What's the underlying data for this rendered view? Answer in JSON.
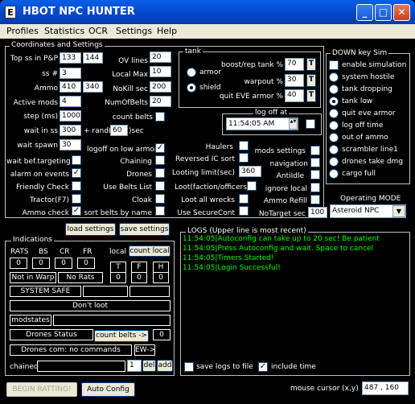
{
  "window": {
    "title": "HBOT NPC HUNTER",
    "minimize": "_",
    "maximize": "□",
    "close": "✕"
  },
  "menu": [
    "Profiles",
    "Statistics",
    "OCR",
    "Settings",
    "Help"
  ],
  "coords": {
    "legend": "Coordinates and Settings",
    "top_ss": {
      "label": "Top ss in P&P",
      "v1": "133",
      "v2": "144"
    },
    "ss_num": {
      "label": "ss #",
      "v": "3"
    },
    "ammo": {
      "label": "Ammo",
      "v1": "410",
      "v2": "340"
    },
    "active_mods": {
      "label": "Active mods",
      "v": "4"
    },
    "step": {
      "label": "step (ms)",
      "v": "1000"
    },
    "wait_ss": {
      "label": "wait in ss",
      "v": "300"
    },
    "rand": {
      "label": "+ rand(",
      "v": "60",
      "suffix": ")sec"
    },
    "wait_spawn": {
      "label": "wait spawn",
      "v": "30"
    },
    "ov_lines": {
      "label": "OV lines",
      "v": "20"
    },
    "local_max": {
      "label": "Local Max",
      "v": "10"
    },
    "nokill_sec": {
      "label": "NoKill sec",
      "v": "200"
    },
    "num_belts": {
      "label": "NumOfBelts",
      "v": "20"
    },
    "count_belts": {
      "label": "count belts",
      "checked": false
    },
    "logoff_low_armor": {
      "label": "logoff on low armor",
      "checked": true
    },
    "wait_targeting": {
      "label": "wait bef.targeting",
      "checked": false
    },
    "alarm_events": {
      "label": "alarm on events",
      "checked": true
    },
    "friendly_check": {
      "label": "Friendly Check",
      "checked": false
    },
    "tractor": {
      "label": "Tractor(F7)",
      "checked": false
    },
    "ammo_check": {
      "label": "Ammo check",
      "checked": true
    },
    "chaining": {
      "label": "Chaining",
      "checked": false
    },
    "drones": {
      "label": "Drones",
      "checked": false
    },
    "use_belts_list": {
      "label": "Use Belts List",
      "checked": false
    },
    "cloak": {
      "label": "Cloak",
      "checked": false
    },
    "sort_belts": {
      "label": "sort belts by name",
      "checked": false
    },
    "haulers": {
      "label": "Haulers",
      "checked": false
    },
    "reversed_ic": {
      "label": "Reversed IC sort",
      "checked": false
    },
    "looting_limit": {
      "label": "Looting limit(sec)",
      "v": "360"
    },
    "loot_faction": {
      "label": "Loot(faction/officers)",
      "checked": false
    },
    "loot_all_wrecks": {
      "label": "Loot all wrecks",
      "checked": false
    },
    "use_securecont": {
      "label": "Use SecureCont",
      "checked": false
    },
    "mods_settings": {
      "label": "mods settings",
      "checked": false
    },
    "navigation": {
      "label": "navigation",
      "checked": false
    },
    "antiidle": {
      "label": "AntiIdle",
      "checked": false
    },
    "ignore_local": {
      "label": "ignore local",
      "checked": false
    },
    "ammo_refill": {
      "label": "Ammo Refill",
      "checked": false
    },
    "notarget_sec": {
      "label": "NoTarget sec",
      "v": "100"
    }
  },
  "tank": {
    "legend": "tank",
    "armor": "armor",
    "shield": "shield",
    "selected": "shield",
    "boost": {
      "label": "boost/rep tank %",
      "v": "70",
      "t": "T"
    },
    "warpout": {
      "label": "warpout %",
      "v": "30",
      "t": "T"
    },
    "quit_eve": {
      "label": "quit EVE armor %",
      "v": "40",
      "t": "T"
    }
  },
  "logoff": {
    "legend": "log off at",
    "time": "11:54:05 AM",
    "spin": "▲▼",
    "checked": false
  },
  "downkey": {
    "legend": "DOWN key Sim",
    "items": [
      {
        "label": "enable simulation",
        "type": "check",
        "checked": false
      },
      {
        "label": "system hostile",
        "type": "radio",
        "checked": false
      },
      {
        "label": "tank dropping",
        "type": "radio",
        "checked": false
      },
      {
        "label": "tank low",
        "type": "radio",
        "checked": true
      },
      {
        "label": "quit eve armor",
        "type": "radio",
        "checked": false
      },
      {
        "label": "log off time",
        "type": "radio",
        "checked": false
      },
      {
        "label": "out of ammo",
        "type": "radio",
        "checked": false
      },
      {
        "label": "scrambler line1",
        "type": "radio",
        "checked": false
      },
      {
        "label": "drones take dmg",
        "type": "radio",
        "checked": false
      },
      {
        "label": "cargo full",
        "type": "radio",
        "checked": false
      }
    ]
  },
  "mode": {
    "label": "Operating MODE",
    "value": "Asteroid NPC",
    "arrow": "▼"
  },
  "buttons": {
    "load": "load settings",
    "save": "save settings",
    "begin": "BEGIN RATTING!",
    "auto": "Auto Config"
  },
  "indications": {
    "legend": "Indications",
    "rats": "RATS",
    "bs": "BS",
    "cr": "CR",
    "fr": "FR",
    "local": "local",
    "count_local": "count local",
    "vals": [
      "0",
      "0",
      "0",
      "0"
    ],
    "t": "T",
    "f": "F",
    "h": "H",
    "tfh": [
      "0",
      "0",
      "0"
    ],
    "not_in_warp": "Not in Warp",
    "no_rats": "No Rats",
    "system_safe": "SYSTEM SAFE",
    "dont_loot": "Don't loot",
    "modstates": "modstates",
    "drones_status": "Drones Status",
    "count_belts_btn": "count belts ->",
    "belts_count": "0",
    "drones_com": "Drones com: no commands",
    "ew": "EW->",
    "chained": "chained",
    "chained_num": "1",
    "del": "del",
    "add": "add"
  },
  "logs": {
    "legend": "LOGS (Upper line is most recent)",
    "lines": [
      "11:54:05|Autoconfig can take up to 20 sec! Be patient",
      "11:54:05|Press Autoconfig and wait. Space to cancel",
      "11:54:05|Timers Started!",
      "11:54:05|Login Successful!"
    ],
    "save_logs": {
      "label": "save logs to file",
      "checked": false
    },
    "include_time": {
      "label": "include time",
      "checked": true
    }
  },
  "cursor": {
    "label": "mouse cursor (x,y)",
    "value": "487 , 160"
  }
}
